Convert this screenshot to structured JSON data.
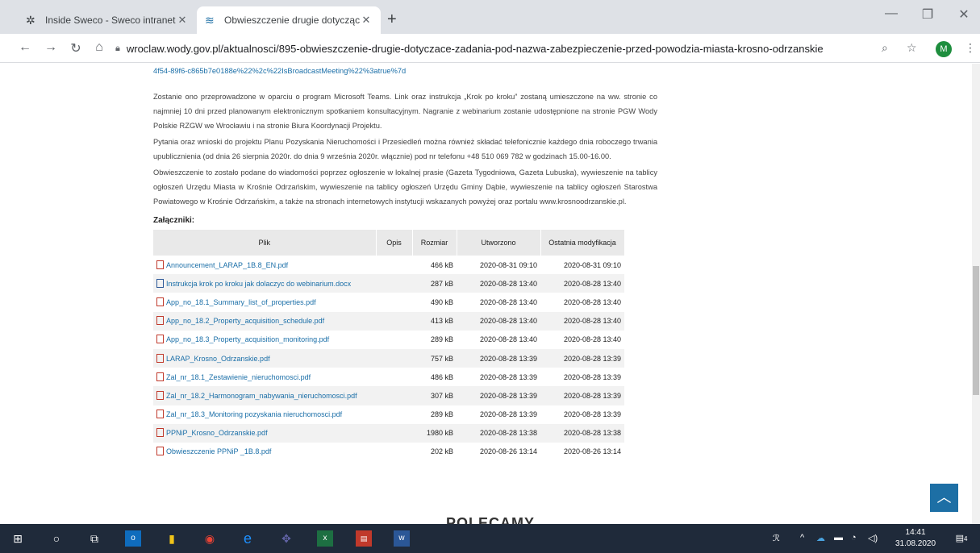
{
  "browser": {
    "tabs": [
      {
        "title": "Inside Sweco - Sweco intranet"
      },
      {
        "title": "Obwieszczenie drugie dotyczące"
      }
    ],
    "url": "wroclaw.wody.gov.pl/aktualnosci/895-obwieszczenie-drugie-dotyczace-zadania-pod-nazwa-zabezpieczenie-przed-powodzia-miasta-krosno-odrzanskie",
    "profile_initial": "M"
  },
  "content": {
    "url_tail": "4f54-89f6-c865b7e0188e%22%2c%22IsBroadcastMeeting%22%3atrue%7d",
    "paragraphs": [
      "Zostanie ono przeprowadzone w oparciu o program Microsoft Teams. Link oraz instrukcja „Krok po kroku” zostaną umieszczone na ww. stronie co najmniej 10 dni przed planowanym elektronicznym spotkaniem konsultacyjnym. Nagranie z webinarium zostanie udostępnione na stronie PGW Wody Polskie RZGW we Wrocławiu i na stronie Biura Koordynacji Projektu.",
      "Pytania oraz wnioski do projektu Planu Pozyskania Nieruchomości i Przesiedleń można również składać telefonicznie każdego dnia roboczego trwania upublicznienia (od dnia 26 sierpnia 2020r. do dnia 9 września 2020r. włącznie) pod nr telefonu +48 510 069 782 w godzinach 15.00-16.00.",
      "Obwieszczenie to zostało podane do wiadomości poprzez ogłoszenie w lokalnej prasie (Gazeta Tygodniowa, Gazeta Lubuska), wywieszenie na tablicy ogłoszeń Urzędu Miasta w Krośnie Odrzańskim, wywieszenie na tablicy ogłoszeń Urzędu Gminy Dąbie, wywieszenie na tablicy ogłoszeń Starostwa Powiatowego w Krośnie Odrzańskim, a także na stronach internetowych instytucji wskazanych powyżej oraz portalu www.krosnoodrzanskie.pl."
    ],
    "attachments_title": "Załączniki:",
    "table_headers": [
      "Plik",
      "Opis",
      "Rozmiar",
      "Utworzono",
      "Ostatnia modyfikacja"
    ],
    "files": [
      {
        "name": "Announcement_LARAP_1B.8_EN.pdf",
        "type": "pdf",
        "opis": "",
        "size": "466 kB",
        "created": "2020-08-31 09:10",
        "modified": "2020-08-31 09:10"
      },
      {
        "name": "Instrukcja krok po kroku jak dolaczyc do webinarium.docx",
        "type": "doc",
        "opis": "",
        "size": "287 kB",
        "created": "2020-08-28 13:40",
        "modified": "2020-08-28 13:40"
      },
      {
        "name": "App_no_18.1_Summary_list_of_properties.pdf",
        "type": "pdf",
        "opis": "",
        "size": "490 kB",
        "created": "2020-08-28 13:40",
        "modified": "2020-08-28 13:40"
      },
      {
        "name": "App_no_18.2_Property_acquisition_schedule.pdf",
        "type": "pdf",
        "opis": "",
        "size": "413 kB",
        "created": "2020-08-28 13:40",
        "modified": "2020-08-28 13:40"
      },
      {
        "name": "App_no_18.3_Property_acquisition_monitoring.pdf",
        "type": "pdf",
        "opis": "",
        "size": "289 kB",
        "created": "2020-08-28 13:40",
        "modified": "2020-08-28 13:40"
      },
      {
        "name": "LARAP_Krosno_Odrzanskie.pdf",
        "type": "pdf",
        "opis": "",
        "size": "757 kB",
        "created": "2020-08-28 13:39",
        "modified": "2020-08-28 13:39"
      },
      {
        "name": "Zal_nr_18.1_Zestawienie_nieruchomosci.pdf",
        "type": "pdf",
        "opis": "",
        "size": "486 kB",
        "created": "2020-08-28 13:39",
        "modified": "2020-08-28 13:39"
      },
      {
        "name": "Zal_nr_18.2_Harmonogram_nabywania_nieruchomosci.pdf",
        "type": "pdf",
        "opis": "",
        "size": "307 kB",
        "created": "2020-08-28 13:39",
        "modified": "2020-08-28 13:39"
      },
      {
        "name": "Zal_nr_18.3_Monitoring pozyskania nieruchomosci.pdf",
        "type": "pdf",
        "opis": "",
        "size": "289 kB",
        "created": "2020-08-28 13:39",
        "modified": "2020-08-28 13:39"
      },
      {
        "name": "PPNiP_Krosno_Odrzanskie.pdf",
        "type": "pdf",
        "opis": "",
        "size": "1980 kB",
        "created": "2020-08-28 13:38",
        "modified": "2020-08-28 13:38"
      },
      {
        "name": "Obwieszczenie PPNiP _1B.8.pdf",
        "type": "pdf",
        "opis": "",
        "size": "202 kB",
        "created": "2020-08-26 13:14",
        "modified": "2020-08-26 13:14"
      }
    ],
    "section_heading": "POLECAMY"
  },
  "taskbar": {
    "time": "14:41",
    "date": "31.08.2020",
    "notification_count": "4"
  }
}
